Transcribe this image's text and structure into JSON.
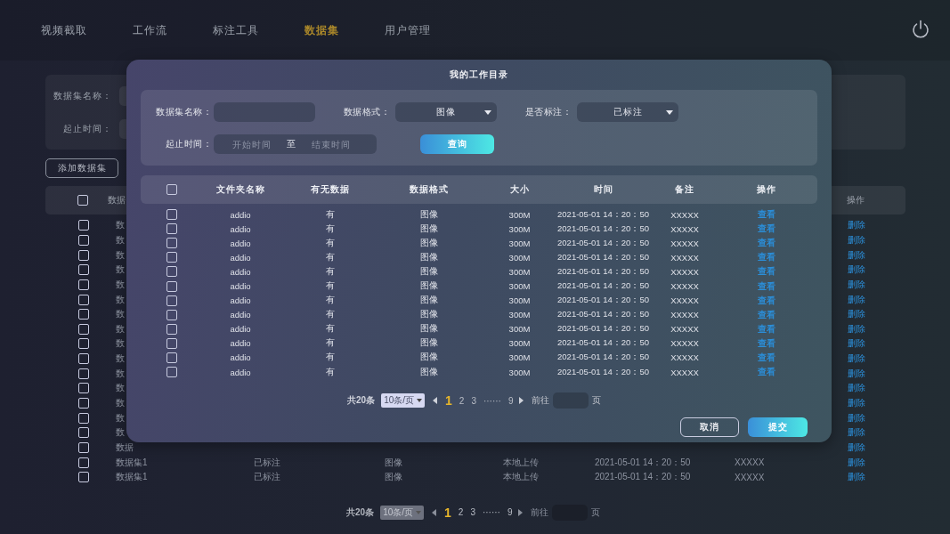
{
  "nav": {
    "items": [
      {
        "label": "视频截取",
        "selected": false
      },
      {
        "label": "工作流",
        "selected": false
      },
      {
        "label": "标注工具",
        "selected": false
      },
      {
        "label": "数据集",
        "selected": true
      },
      {
        "label": "用户管理",
        "selected": false
      }
    ]
  },
  "filters": {
    "name_label": "数据集名称：",
    "time_label": "起止时间："
  },
  "add_button": "添加数据集",
  "table": {
    "header_checked": false,
    "columns": [
      "数据",
      "操作"
    ],
    "rows": [
      {
        "checked": false,
        "name": "数",
        "action": "删除"
      },
      {
        "checked": false,
        "name": "数",
        "action": "删除"
      },
      {
        "checked": false,
        "name": "数",
        "action": "删除"
      },
      {
        "checked": false,
        "name": "数",
        "action": "删除"
      },
      {
        "checked": false,
        "name": "数",
        "action": "删除"
      },
      {
        "checked": false,
        "name": "数",
        "action": "删除"
      },
      {
        "checked": false,
        "name": "数",
        "action": "删除"
      },
      {
        "checked": false,
        "name": "数",
        "action": "删除"
      },
      {
        "checked": false,
        "name": "数",
        "action": "删除"
      },
      {
        "checked": false,
        "name": "数",
        "action": "删除"
      },
      {
        "checked": false,
        "name": "数",
        "action": "删除"
      },
      {
        "checked": false,
        "name": "数",
        "action": "删除"
      },
      {
        "checked": false,
        "name": "数",
        "action": "删除"
      },
      {
        "checked": false,
        "name": "数",
        "action": "删除"
      },
      {
        "checked": false,
        "name": "数",
        "action": "删除"
      },
      {
        "checked": false,
        "name": "数据",
        "action": "删除"
      },
      {
        "checked": false,
        "name": "数据集1",
        "status": "已标注",
        "format": "图像",
        "source": "本地上传",
        "time": "2021-05-01 14：20：50",
        "note": "XXXXX",
        "action": "删除"
      },
      {
        "checked": false,
        "name": "数据集1",
        "status": "已标注",
        "format": "图像",
        "source": "本地上传",
        "time": "2021-05-01 14：20：50",
        "note": "XXXXX",
        "action": "删除"
      }
    ]
  },
  "pagination": {
    "total": "共20条",
    "page_size": "10条/页",
    "pages": [
      {
        "label": "1",
        "selected": true
      },
      {
        "label": "2",
        "selected": false
      },
      {
        "label": "3",
        "selected": false
      },
      {
        "label": "······",
        "selected": false
      },
      {
        "label": "9",
        "selected": false
      }
    ],
    "goto": "前往",
    "unit": "页"
  },
  "dialog": {
    "title": "我的工作目录",
    "filters": {
      "name_label": "数据集名称：",
      "format_label": "数据格式：",
      "format_value": "图像",
      "annotated_label": "是否标注：",
      "annotated_value": "已标注",
      "time_label": "起止时间：",
      "start_placeholder": "开始时间",
      "separator": "至",
      "end_placeholder": "结束时间",
      "query_button": "查询"
    },
    "table": {
      "header_checked": false,
      "columns": [
        "文件夹名称",
        "有无数据",
        "数据格式",
        "大小",
        "时间",
        "备注",
        "操作"
      ],
      "rows": [
        {
          "checked": false,
          "cells": [
            "addio",
            "有",
            "图像",
            "300M",
            "2021-05-01 14：20：50",
            "XXXXX"
          ],
          "action": "查看"
        },
        {
          "checked": false,
          "cells": [
            "addio",
            "有",
            "图像",
            "300M",
            "2021-05-01 14：20：50",
            "XXXXX"
          ],
          "action": "查看"
        },
        {
          "checked": false,
          "cells": [
            "addio",
            "有",
            "图像",
            "300M",
            "2021-05-01 14：20：50",
            "XXXXX"
          ],
          "action": "查看"
        },
        {
          "checked": false,
          "cells": [
            "addio",
            "有",
            "图像",
            "300M",
            "2021-05-01 14：20：50",
            "XXXXX"
          ],
          "action": "查看"
        },
        {
          "checked": false,
          "cells": [
            "addio",
            "有",
            "图像",
            "300M",
            "2021-05-01 14：20：50",
            "XXXXX"
          ],
          "action": "查看"
        },
        {
          "checked": false,
          "cells": [
            "addio",
            "有",
            "图像",
            "300M",
            "2021-05-01 14：20：50",
            "XXXXX"
          ],
          "action": "查看"
        },
        {
          "checked": false,
          "cells": [
            "addio",
            "有",
            "图像",
            "300M",
            "2021-05-01 14：20：50",
            "XXXXX"
          ],
          "action": "查看"
        },
        {
          "checked": false,
          "cells": [
            "addio",
            "有",
            "图像",
            "300M",
            "2021-05-01 14：20：50",
            "XXXXX"
          ],
          "action": "查看"
        },
        {
          "checked": false,
          "cells": [
            "addio",
            "有",
            "图像",
            "300M",
            "2021-05-01 14：20：50",
            "XXXXX"
          ],
          "action": "查看"
        },
        {
          "checked": false,
          "cells": [
            "addio",
            "有",
            "图像",
            "300M",
            "2021-05-01 14：20：50",
            "XXXXX"
          ],
          "action": "查看"
        },
        {
          "checked": false,
          "cells": [
            "addio",
            "有",
            "图像",
            "300M",
            "2021-05-01 14：20：50",
            "XXXXX"
          ],
          "action": "查看"
        },
        {
          "checked": false,
          "cells": [
            "addio",
            "有",
            "图像",
            "300M",
            "2021-05-01 14：20：50",
            "XXXXX"
          ],
          "action": "查看"
        }
      ]
    },
    "pagination": {
      "total": "共20条",
      "page_size": "10条/页",
      "pages": [
        {
          "label": "1",
          "selected": true
        },
        {
          "label": "2",
          "selected": false
        },
        {
          "label": "3",
          "selected": false
        },
        {
          "label": "······",
          "selected": false
        },
        {
          "label": "9",
          "selected": false
        }
      ],
      "goto": "前往",
      "unit": "页"
    },
    "cancel_button": "取消",
    "submit_button": "提交"
  }
}
